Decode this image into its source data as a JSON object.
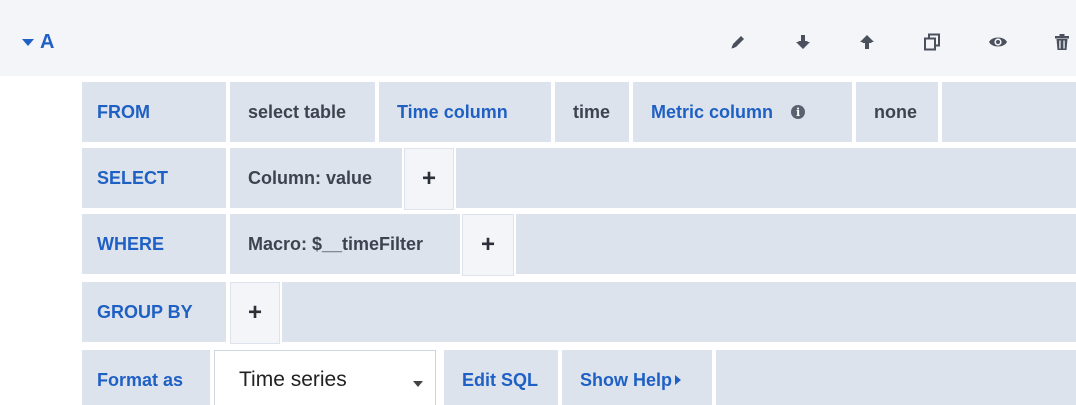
{
  "header": {
    "query_letter": "A",
    "actions": [
      {
        "name": "pencil-icon"
      },
      {
        "name": "arrow-down-icon"
      },
      {
        "name": "arrow-up-icon"
      },
      {
        "name": "duplicate-icon"
      },
      {
        "name": "eye-icon"
      },
      {
        "name": "trash-icon"
      }
    ]
  },
  "rows": {
    "from": {
      "keyword": "FROM",
      "table": "select table",
      "time_column_label": "Time column",
      "time_column_value": "time",
      "metric_column_label": "Metric column",
      "info_icon": "i",
      "metric_column_value": "none"
    },
    "select": {
      "keyword": "SELECT",
      "column": "Column: value",
      "add": "+"
    },
    "where": {
      "keyword": "WHERE",
      "macro": "Macro: $__timeFilter",
      "add": "+"
    },
    "group_by": {
      "keyword": "GROUP BY",
      "add": "+"
    },
    "format": {
      "label": "Format as",
      "selected": "Time series",
      "edit_sql": "Edit SQL",
      "show_help": "Show Help"
    }
  },
  "colors": {
    "accent": "#1f60c4",
    "cell_bg": "#dde3ec",
    "header_bg": "#f4f5f8",
    "text": "#3d4450"
  }
}
